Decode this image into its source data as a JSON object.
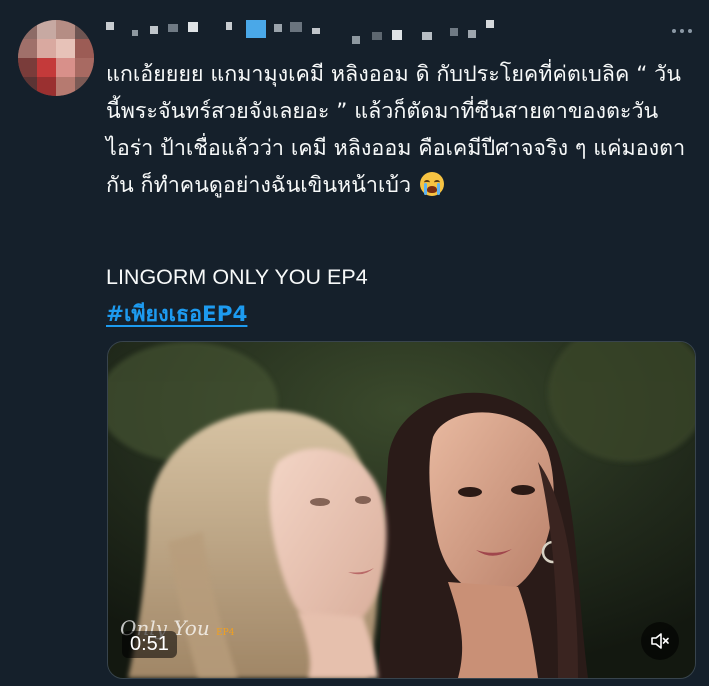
{
  "tweet": {
    "author_name": "",
    "text": "แกเอ้ยยยย แกมามุงเคมี หลิงออม ดิ กับประโยคที่ค่ตเบลิค “ วันนี้พระจันทร์สวยจังเลยอะ ” แล้วก็ตัดมาที่ซีนสายตาของตะวัน ไอร่า ป้าเชื่อแล้วว่า เคมี หลิงออม คือเคมีปีศาจจริง ๆ แค่มองตากัน ก็ทำคนดูอย่างฉันเขินหน้าเบ้ว",
    "emoji": "loudly-crying-face",
    "caption": "LINGORM ONLY YOU EP4",
    "hashtag": "#เพียงเธอEP4"
  },
  "video": {
    "duration": "0:51",
    "mute_icon": "speaker-muted-icon",
    "logo_text": "Only You",
    "logo_sub": "EP4"
  },
  "colors": {
    "background": "#15202b",
    "text": "#f7f9f9",
    "link": "#1d9bf0",
    "muted": "#8b98a5"
  }
}
